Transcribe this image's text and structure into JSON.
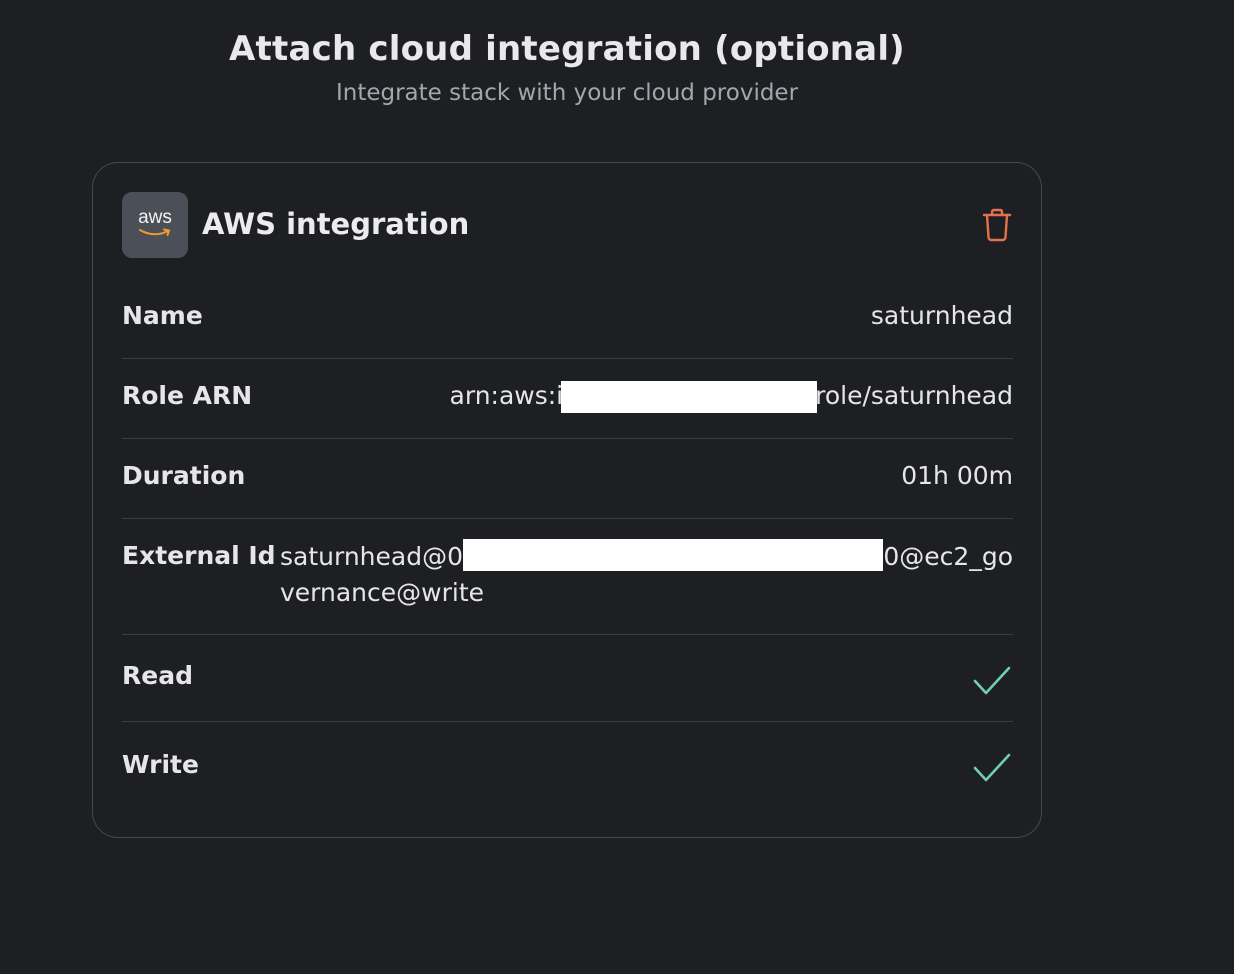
{
  "header": {
    "title": "Attach cloud integration (optional)",
    "subtitle": "Integrate stack with your cloud provider"
  },
  "integration": {
    "logo_text": "aws",
    "title": "AWS integration",
    "delete_icon": "trash-icon",
    "rows": {
      "name": {
        "label": "Name",
        "value": "saturnhead"
      },
      "role_arn": {
        "label": "Role ARN",
        "prefix": "arn:aws:i",
        "suffix": "role/saturnhead"
      },
      "duration": {
        "label": "Duration",
        "value": "01h 00m"
      },
      "external_id": {
        "label": "External Id",
        "prefix": "saturnhead@0",
        "suffix": "0@ec2_go",
        "line2": "vernance@write"
      },
      "read": {
        "label": "Read",
        "icon": "check-icon",
        "enabled": true
      },
      "write": {
        "label": "Write",
        "icon": "check-icon",
        "enabled": true
      }
    }
  },
  "colors": {
    "background": "#1e1f23",
    "card_border": "#46484f",
    "delete": "#e5704f",
    "check": "#6fcfb3"
  }
}
